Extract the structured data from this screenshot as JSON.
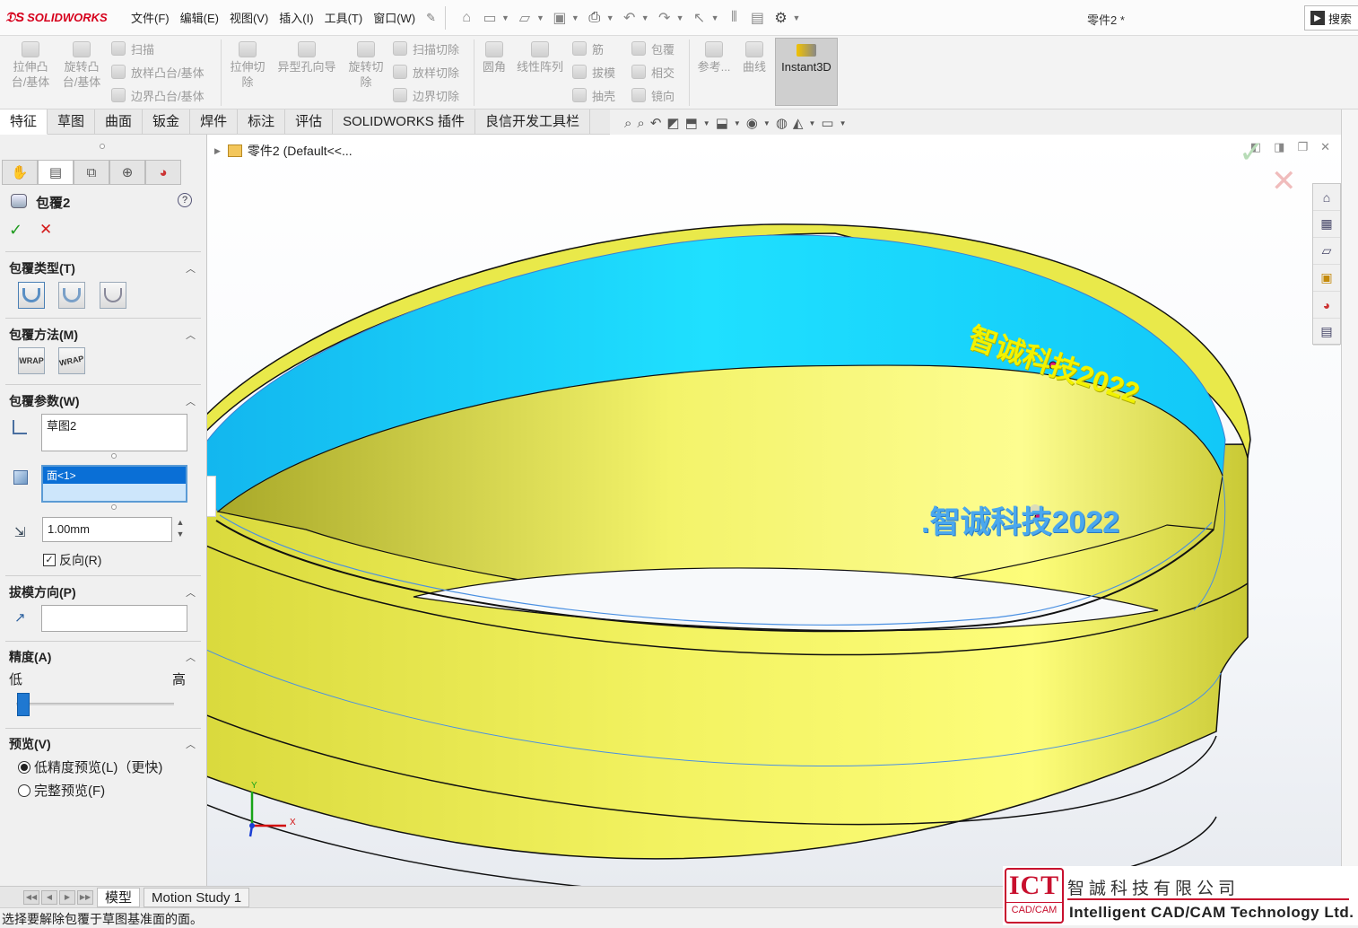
{
  "app": {
    "brand": "SOLIDWORKS",
    "doc_title": "零件2 *",
    "search_label": "搜索"
  },
  "menu": [
    "文件(F)",
    "编辑(E)",
    "视图(V)",
    "插入(I)",
    "工具(T)",
    "窗口(W)"
  ],
  "ribbon": {
    "extrude_boss": "拉伸凸\n台/基体",
    "revolve_boss": "旋转凸\n台/基体",
    "sweep": "扫描",
    "loft_boss": "放样凸台/基体",
    "boundary_boss": "边界凸台/基体",
    "extrude_cut": "拉伸切\n除",
    "hole_wizard": "异型孔向导",
    "revolve_cut": "旋转切\n除",
    "sweep_cut": "扫描切除",
    "loft_cut": "放样切除",
    "boundary_cut": "边界切除",
    "fillet": "圆角",
    "linear_pattern": "线性阵列",
    "rib": "筋",
    "draft": "拔模",
    "shell": "抽壳",
    "wrap": "包覆",
    "intersect": "相交",
    "mirror": "镜向",
    "reference": "参考...",
    "curves": "曲线",
    "instant3d": "Instant3D"
  },
  "command_tabs": [
    "特征",
    "草图",
    "曲面",
    "钣金",
    "焊件",
    "标注",
    "评估",
    "SOLIDWORKS 插件",
    "良信开发工具栏"
  ],
  "property_manager": {
    "title": "包覆2",
    "wrap_type": {
      "title": "包覆类型(T)"
    },
    "wrap_method": {
      "title": "包覆方法(M)",
      "btn1": "WRAP",
      "btn2": "WRAP"
    },
    "wrap_params": {
      "title": "包覆参数(W)",
      "sketch_value": "草图2",
      "face_value": "面<1>",
      "thickness": "1.00mm",
      "reverse_label": "反向(R)",
      "reverse_checked": true
    },
    "pull_direction": {
      "title": "拔模方向(P)",
      "value": ""
    },
    "accuracy": {
      "title": "精度(A)",
      "low": "低",
      "high": "高",
      "level": 0.0
    },
    "preview": {
      "title": "预览(V)",
      "low_label": "低精度预览(L)（更快)",
      "full_label": "完整预览(F)",
      "selected": "low"
    }
  },
  "graphics": {
    "tree_root": "零件2  (Default<<...",
    "text_top": "智诚科技2022",
    "text_inner": ".智诚科技2022",
    "axis_x": "X",
    "axis_y": "Y"
  },
  "bottom_tabs": [
    "模型",
    "Motion Study 1"
  ],
  "status_text": "选择要解除包覆于草图基准面的面。",
  "watermark": {
    "logo_big": "ICT",
    "logo_small": "CAD/CAM",
    "company_cn": "智誠科技有限公司",
    "company_en": "Intelligent CAD/CAM Technology Ltd."
  },
  "colors": {
    "ring": "#eded4a",
    "ring_dark": "#c8c838",
    "inner_face": "#1ec8f5",
    "text_top": "#f2f200",
    "text_inner": "#4aa8ee"
  }
}
